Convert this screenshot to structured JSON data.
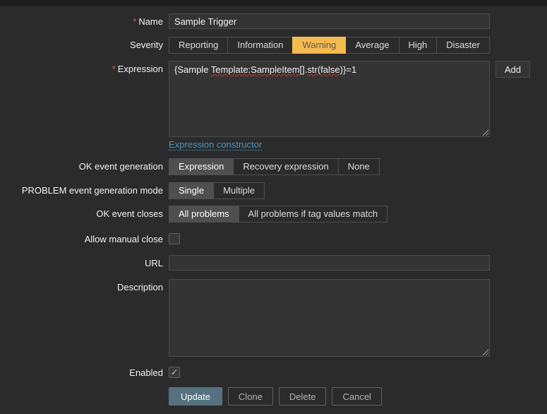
{
  "colors": {
    "page-bg": "#2b2b2b",
    "accent-warning-bg": "#f4bb50",
    "link": "#4796c4",
    "primary-btn-bg": "#55707e",
    "required-red": "#e45959"
  },
  "form": {
    "required_marker": "*",
    "name": {
      "label": "Name",
      "value": "Sample Trigger"
    },
    "severity": {
      "label": "Severity",
      "options": [
        "Reporting",
        "Information",
        "Warning",
        "Average",
        "High",
        "Disaster"
      ],
      "selected": "Warning"
    },
    "expression": {
      "label": "Expression",
      "value": "{Sample Template:SampleItem[].str(false)}=1",
      "spellcheck_segments": [
        {
          "text": "{Sample ",
          "misspelled": false
        },
        {
          "text": "Template:SampleItem[]",
          "misspelled": true
        },
        {
          "text": ".",
          "misspelled": false
        },
        {
          "text": "str",
          "misspelled": true
        },
        {
          "text": "(",
          "misspelled": false
        },
        {
          "text": "false",
          "misspelled": true
        },
        {
          "text": ")}=1",
          "misspelled": false
        }
      ],
      "add_button": "Add",
      "constructor_link": "Expression constructor"
    },
    "ok_event_generation": {
      "label": "OK event generation",
      "options": [
        "Expression",
        "Recovery expression",
        "None"
      ],
      "selected": "Expression"
    },
    "problem_event_generation_mode": {
      "label": "PROBLEM event generation mode",
      "options": [
        "Single",
        "Multiple"
      ],
      "selected": "Single"
    },
    "ok_event_closes": {
      "label": "OK event closes",
      "options": [
        "All problems",
        "All problems if tag values match"
      ],
      "selected": "All problems"
    },
    "allow_manual_close": {
      "label": "Allow manual close",
      "checked": false
    },
    "url": {
      "label": "URL",
      "value": ""
    },
    "description": {
      "label": "Description",
      "value": ""
    },
    "enabled": {
      "label": "Enabled",
      "checked": true
    },
    "footer_buttons": {
      "update": "Update",
      "clone": "Clone",
      "delete": "Delete",
      "cancel": "Cancel"
    }
  }
}
